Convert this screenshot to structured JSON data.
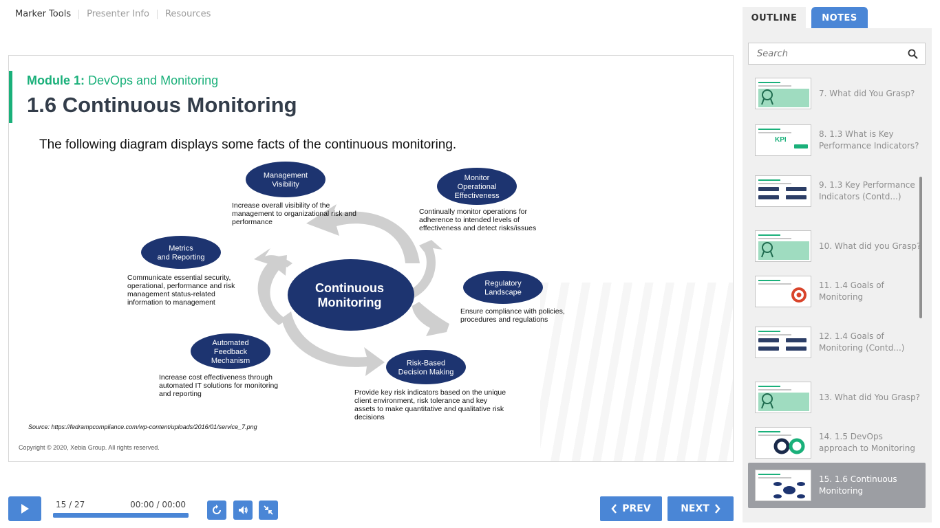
{
  "topnav": {
    "items": [
      {
        "label": "Marker Tools"
      },
      {
        "label": "Presenter Info"
      },
      {
        "label": "Resources"
      }
    ]
  },
  "slide": {
    "module_prefix": "Module 1:",
    "module_name": "DevOps and Monitoring",
    "title": "1.6 Continuous Monitoring",
    "intro": "The following diagram displays some facts of the continuous monitoring.",
    "diagram": {
      "center_line1": "Continuous",
      "center_line2": "Monitoring",
      "nodes": [
        {
          "lines": [
            "Management",
            "Visibility"
          ],
          "desc": [
            "Increase overall visibility of the",
            "management to organizational risk and",
            "performance"
          ]
        },
        {
          "lines": [
            "Monitor",
            "Operational",
            "Effectiveness"
          ],
          "desc": [
            "Continually monitor operations for",
            "adherence to intended levels of",
            "effectiveness and detect risks/issues"
          ]
        },
        {
          "lines": [
            "Metrics",
            "and Reporting"
          ],
          "desc": [
            "Communicate essential security,",
            "operational, performance and risk",
            "management status-related",
            "information to management"
          ]
        },
        {
          "lines": [
            "Regulatory",
            "Landscape"
          ],
          "desc": [
            "Ensure compliance with policies,",
            "procedures and regulations"
          ]
        },
        {
          "lines": [
            "Automated",
            "Feedback",
            "Mechanism"
          ],
          "desc": [
            "Increase cost effectiveness through",
            "automated IT solutions for monitoring",
            "and reporting"
          ]
        },
        {
          "lines": [
            "Risk-Based",
            "Decision Making"
          ],
          "desc": [
            "Provide key risk indicators based on the unique",
            "client environment, risk tolerance and key",
            "assets to make quantitative and qualitative risk",
            "decisions"
          ]
        }
      ]
    },
    "source": "Source: https://fedrampcompliance.com/wp-content/uploads/2016/01/service_7.png",
    "copyright": "Copyright © 2020, Xebia Group. All rights reserved."
  },
  "player": {
    "slide_counter": "15 / 27",
    "time": "00:00 / 00:00",
    "progress_fraction": 1.0,
    "prev_label": "PREV",
    "next_label": "NEXT"
  },
  "sidebar": {
    "tab_outline": "OUTLINE",
    "tab_notes": "NOTES",
    "search_placeholder": "Search",
    "items": [
      {
        "label": "7. What did You Grasp?",
        "thumb": "grasp"
      },
      {
        "label": "8. 1.3 What is Key Performance Indicators?",
        "thumb": "kpi"
      },
      {
        "label": "9. 1.3 Key Performance Indicators (Contd...)",
        "thumb": "bars"
      },
      {
        "label": "10. What did you Grasp?",
        "thumb": "grasp"
      },
      {
        "label": "11. 1.4 Goals of Monitoring",
        "thumb": "target"
      },
      {
        "label": "12. 1.4 Goals of Monitoring (Contd...)",
        "thumb": "bars"
      },
      {
        "label": "13. What did You Grasp?",
        "thumb": "grasp"
      },
      {
        "label": "14. 1.5 DevOps approach to Monitoring",
        "thumb": "devops"
      },
      {
        "label": "15. 1.6 Continuous Monitoring",
        "thumb": "diagram",
        "active": true
      }
    ]
  },
  "colors": {
    "accent_blue": "#4a86d6",
    "accent_green": "#1ab07a",
    "node_navy": "#1d3470",
    "active_item": "#9c9ea3"
  }
}
